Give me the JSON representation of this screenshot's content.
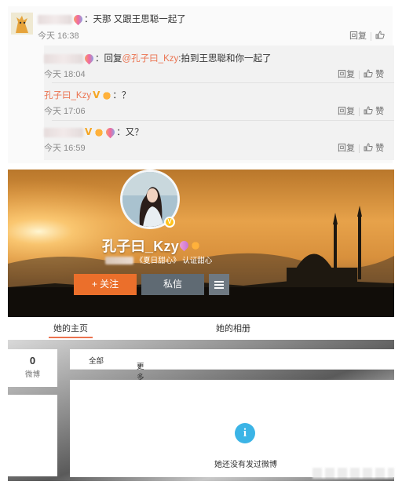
{
  "comments": {
    "main": {
      "text": "：天那  又跟王思聪一起了",
      "time": "今天 16:38",
      "reply_label": "回复"
    },
    "replies": [
      {
        "prefix": "：回复",
        "mention": "@孔子曰_Kzy",
        "text": ":拍到王思聪和你一起了",
        "time": "今天 18:04",
        "reply_label": "回复",
        "like_label": "赞"
      },
      {
        "author": "孔子曰_Kzy",
        "text": "：？",
        "time": "今天 17:06",
        "reply_label": "回复",
        "like_label": "赞"
      },
      {
        "text": "：又？",
        "time": "今天 16:59",
        "reply_label": "回复",
        "like_label": "赞"
      }
    ]
  },
  "profile": {
    "name": "孔子曰_Kzy",
    "subtitle_tag": "《夏日甜心》",
    "subtitle_role": "认证甜心",
    "verified_mark": "V",
    "follow_label": "+ 关注",
    "message_label": "私信"
  },
  "tabs": {
    "home": "她的主页",
    "album": "她的相册"
  },
  "stats": {
    "weibo_count": "0",
    "weibo_label": "微博"
  },
  "feed": {
    "filter_all": "全部",
    "filter_more": "更多",
    "empty_icon": "i",
    "empty_text": "她还没有发过微博"
  },
  "colors": {
    "accent_orange": "#eb7350",
    "follow_button": "#eb6f2b",
    "message_button": "#5f6a73",
    "info_icon": "#3bb4e6"
  }
}
